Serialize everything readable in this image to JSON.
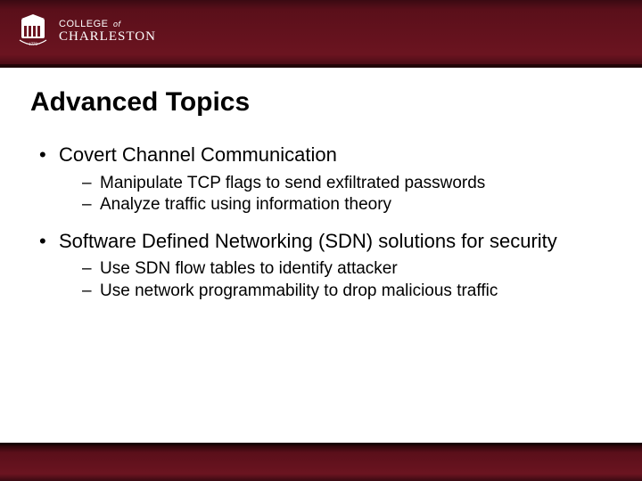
{
  "header": {
    "logo": {
      "line1_text": "COLLEGE",
      "line1_of": "of",
      "line2": "CHARLESTON",
      "crest_icon": "college-crest"
    }
  },
  "slide": {
    "title": "Advanced Topics",
    "bullets": [
      {
        "text": "Covert Channel Communication",
        "subs": [
          "Manipulate TCP flags to send exfiltrated passwords",
          "Analyze traffic using information theory"
        ]
      },
      {
        "text": "Software Defined Networking (SDN) solutions for security",
        "subs": [
          "Use SDN flow tables to identify attacker",
          "Use network programmability to drop malicious traffic"
        ]
      }
    ]
  }
}
